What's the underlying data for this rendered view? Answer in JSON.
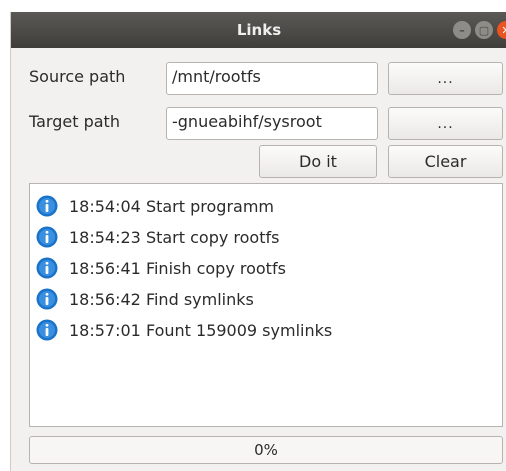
{
  "window": {
    "title": "Links"
  },
  "form": {
    "source_label": "Source path",
    "source_value": "/mnt/rootfs",
    "source_browse": "...",
    "target_label": "Target path",
    "target_value": "-gnueabihf/sysroot",
    "target_browse": "...",
    "do_it_label": "Do it",
    "clear_label": "Clear"
  },
  "log": {
    "entries": [
      {
        "icon": "info-icon",
        "text": "18:54:04 Start programm"
      },
      {
        "icon": "info-icon",
        "text": "18:54:23 Start copy rootfs"
      },
      {
        "icon": "info-icon",
        "text": "18:56:41 Finish copy rootfs"
      },
      {
        "icon": "info-icon",
        "text": "18:56:42 Find symlinks"
      },
      {
        "icon": "info-icon",
        "text": "18:57:01 Fount 159009 symlinks"
      }
    ]
  },
  "progress": {
    "value": 0,
    "text": "0%"
  },
  "colors": {
    "accent": "#e95420",
    "titlebar": "#3f3e3b",
    "info_icon": "#1a73c9"
  }
}
